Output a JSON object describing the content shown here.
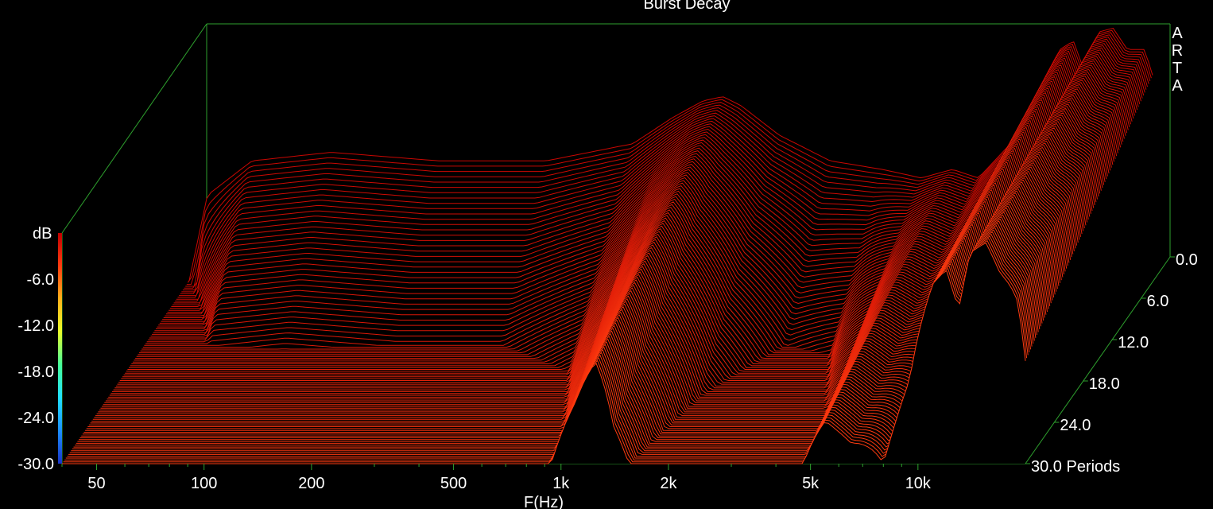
{
  "chart_data": {
    "type": "waterfall-3d",
    "title": "Burst Decay",
    "watermark": "ARTA",
    "xlabel": "F(Hz)",
    "zlabel": "dB",
    "x_scale": "log",
    "xlim": [
      40,
      20000
    ],
    "x_ticks": [
      {
        "v": 50,
        "label": "50"
      },
      {
        "v": 100,
        "label": "100"
      },
      {
        "v": 200,
        "label": "200"
      },
      {
        "v": 500,
        "label": "500"
      },
      {
        "v": 1000,
        "label": "1k"
      },
      {
        "v": 2000,
        "label": "2k"
      },
      {
        "v": 5000,
        "label": "5k"
      },
      {
        "v": 10000,
        "label": "10k"
      }
    ],
    "zlim": [
      -30,
      0
    ],
    "z_ticks": [
      "-6.0",
      "-12.0",
      "-18.0",
      "-24.0",
      "-30.0"
    ],
    "z_tick_values": [
      -6,
      -12,
      -18,
      -24,
      -30
    ],
    "period_ticks": [
      "0.0",
      "6.0",
      "12.0",
      "18.0",
      "24.0",
      "30.0 Periods"
    ],
    "period_tick_values": [
      0,
      6,
      12,
      18,
      24,
      30
    ],
    "periods_range": [
      0,
      30
    ],
    "colormap": [
      "#1a35c8",
      "#1c8fff",
      "#20e0ff",
      "#46ff9a",
      "#e9ff2a",
      "#ffb21a",
      "#ff3c10",
      "#c20000"
    ],
    "colors": {
      "background": "#000000",
      "box": "#2ea12e",
      "floor": "#3a6bff",
      "text": "#ffffff"
    },
    "slices": 100,
    "samples": [
      {
        "f": 40,
        "level": -30,
        "decay": 0.0
      },
      {
        "f": 45,
        "level": -20,
        "decay": 0.4
      },
      {
        "f": 60,
        "level": -16,
        "decay": 1.2
      },
      {
        "f": 100,
        "level": -15,
        "decay": 1.2
      },
      {
        "f": 200,
        "level": -16,
        "decay": 1.2
      },
      {
        "f": 400,
        "level": -16,
        "decay": 1.2
      },
      {
        "f": 700,
        "level": -14,
        "decay": 1.5
      },
      {
        "f": 900,
        "level": -11,
        "decay": 2.2
      },
      {
        "f": 1100,
        "level": -9,
        "decay": 3.5
      },
      {
        "f": 1250,
        "level": -8.5,
        "decay": 5.0
      },
      {
        "f": 1400,
        "level": -9.5,
        "decay": 3.0
      },
      {
        "f": 1800,
        "level": -13,
        "decay": 1.8
      },
      {
        "f": 2500,
        "level": -16,
        "decay": 1.2
      },
      {
        "f": 3500,
        "level": -17,
        "decay": 1.5
      },
      {
        "f": 4500,
        "level": -18,
        "decay": 3.0
      },
      {
        "f": 5500,
        "level": -17,
        "decay": 6.0
      },
      {
        "f": 6500,
        "level": -18,
        "decay": 5.0
      },
      {
        "f": 8000,
        "level": -14,
        "decay": 3.0
      },
      {
        "f": 9500,
        "level": -8,
        "decay": 4.0
      },
      {
        "f": 11000,
        "level": -3,
        "decay": 8.0
      },
      {
        "f": 12000,
        "level": -2,
        "decay": 9.0
      },
      {
        "f": 13000,
        "level": -6,
        "decay": 8.0
      },
      {
        "f": 14000,
        "level": -1,
        "decay": 11.0
      },
      {
        "f": 15500,
        "level": -0.5,
        "decay": 13.0
      },
      {
        "f": 17000,
        "level": -3,
        "decay": 10.0
      },
      {
        "f": 19000,
        "level": -3,
        "decay": 6.0
      },
      {
        "f": 20000,
        "level": -6,
        "decay": 4.0
      }
    ]
  }
}
